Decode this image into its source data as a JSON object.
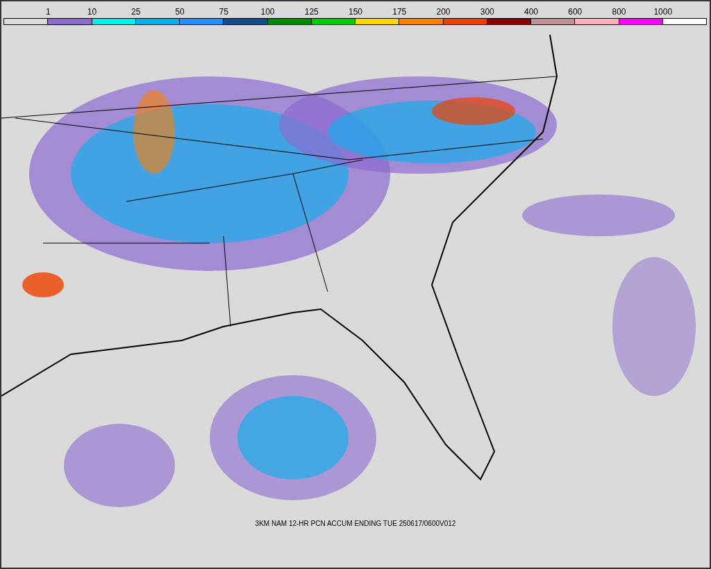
{
  "legend": [
    {
      "color": "#dadada",
      "label": "1"
    },
    {
      "color": "#8b6bd0",
      "label": "10"
    },
    {
      "color": "#00eeee",
      "label": "25"
    },
    {
      "color": "#00b2ee",
      "label": "50"
    },
    {
      "color": "#1e90ff",
      "label": "75"
    },
    {
      "color": "#104e8b",
      "label": "100"
    },
    {
      "color": "#008b00",
      "label": "125"
    },
    {
      "color": "#00cd00",
      "label": "150"
    },
    {
      "color": "#ffd700",
      "label": "175"
    },
    {
      "color": "#ff7f00",
      "label": "200"
    },
    {
      "color": "#ee4000",
      "label": "300"
    },
    {
      "color": "#8b0000",
      "label": "400"
    },
    {
      "color": "#c09098",
      "label": "600"
    },
    {
      "color": "#ffaec0",
      "label": "800"
    },
    {
      "color": "#ff00ff",
      "label": "1000"
    },
    {
      "color": "#ffffff"
    }
  ],
  "caption": "3KM NAM 12-HR PCN ACCUM ENDING TUE 250617/0600V012"
}
